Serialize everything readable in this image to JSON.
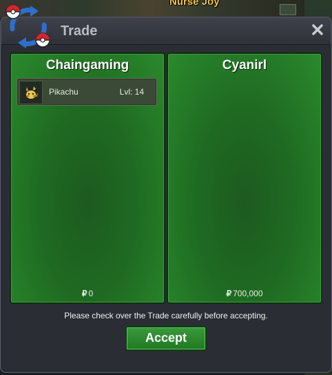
{
  "world": {
    "npc_label": "Nurse Joy"
  },
  "window": {
    "title": "Trade",
    "close_glyph": "✕"
  },
  "panels": [
    {
      "player_name": "Chaingaming",
      "items": [
        {
          "name": "Pikachu",
          "level_text": "Lvl: 14",
          "icon": "pikachu-icon"
        }
      ],
      "money": "0",
      "money_symbol": "₽"
    },
    {
      "player_name": "Cyanirl",
      "items": [],
      "money": "700,000",
      "money_symbol": "₽"
    }
  ],
  "notice": "Please check over the Trade carefully before accepting.",
  "accept_label": "Accept",
  "colors": {
    "panel_green": "#1f6a22",
    "accept_green": "#2c8a2e",
    "window_bg": "#2b2d35",
    "npc_label": "#f0c34a"
  }
}
